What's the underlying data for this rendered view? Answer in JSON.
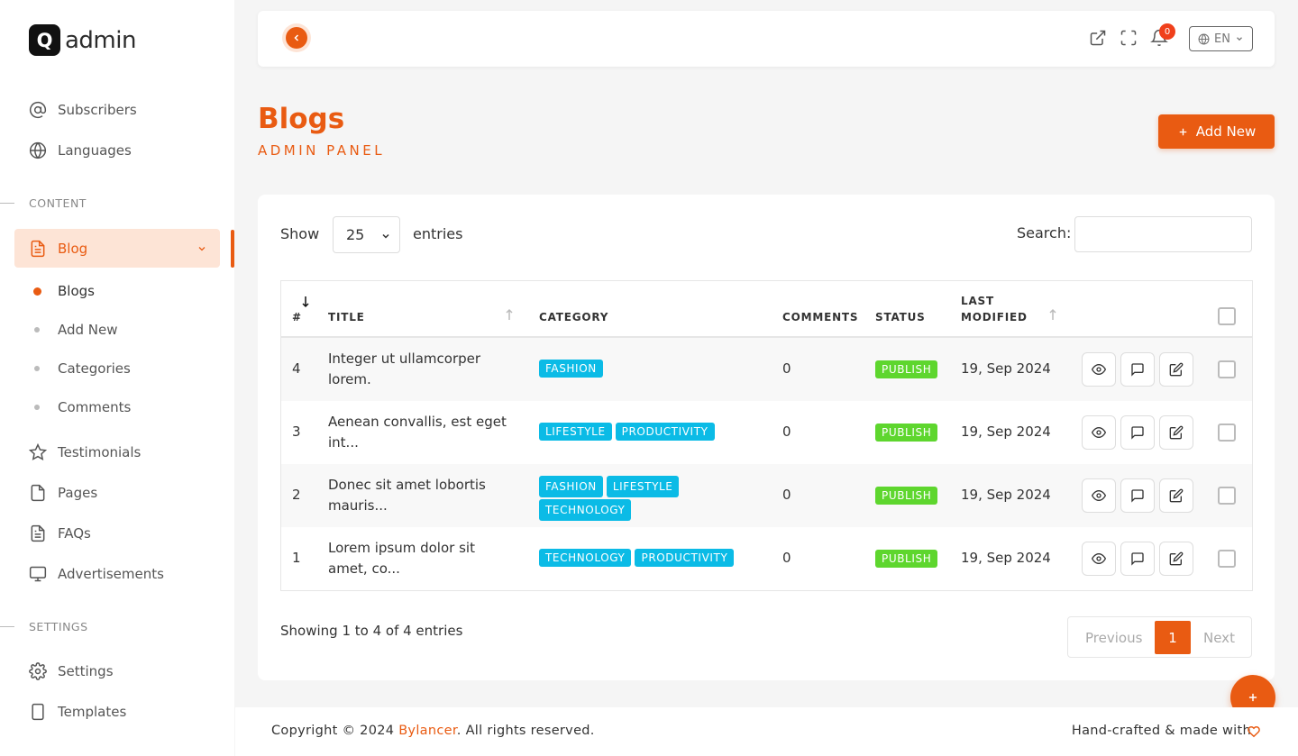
{
  "brand": {
    "logo_letter": "Q",
    "name": "admin"
  },
  "sidebar": {
    "items_top": [
      {
        "label": "Subscribers",
        "icon": "at-icon"
      },
      {
        "label": "Languages",
        "icon": "globe-icon"
      }
    ],
    "content_section": "CONTENT",
    "blog": {
      "label": "Blog",
      "sub_items": [
        "Blogs",
        "Add New",
        "Categories",
        "Comments"
      ]
    },
    "items_content": [
      {
        "label": "Testimonials",
        "icon": "star-icon"
      },
      {
        "label": "Pages",
        "icon": "page-icon"
      },
      {
        "label": "FAQs",
        "icon": "document-icon"
      },
      {
        "label": "Advertisements",
        "icon": "monitor-icon"
      }
    ],
    "settings_section": "SETTINGS",
    "items_settings": [
      {
        "label": "Settings",
        "icon": "gear-icon"
      },
      {
        "label": "Templates",
        "icon": "tablet-icon"
      }
    ]
  },
  "topbar": {
    "notification_count": "0",
    "language": "EN"
  },
  "page": {
    "title": "Blogs",
    "subtitle": "ADMIN PANEL",
    "add_new_label": "Add New"
  },
  "table_controls": {
    "show_label": "Show",
    "page_size": "25",
    "entries_label": "entries",
    "search_label": "Search:",
    "search_value": ""
  },
  "table": {
    "columns": [
      "#",
      "TITLE",
      "CATEGORY",
      "COMMENTS",
      "STATUS",
      "LAST",
      "MODIFIED"
    ],
    "rows": [
      {
        "id": "4",
        "title": "Integer ut ullamcorper lorem.",
        "categories": [
          "FASHION"
        ],
        "comments": "0",
        "status": "PUBLISH",
        "modified": "19, Sep 2024"
      },
      {
        "id": "3",
        "title": "Aenean convallis, est eget int...",
        "categories": [
          "LIFESTYLE",
          "PRODUCTIVITY"
        ],
        "comments": "0",
        "status": "PUBLISH",
        "modified": "19, Sep 2024"
      },
      {
        "id": "2",
        "title": "Donec sit amet lobortis mauris...",
        "categories": [
          "FASHION",
          "LIFESTYLE",
          "TECHNOLOGY"
        ],
        "comments": "0",
        "status": "PUBLISH",
        "modified": "19, Sep 2024"
      },
      {
        "id": "1",
        "title": "Lorem ipsum dolor sit amet, co...",
        "categories": [
          "TECHNOLOGY",
          "PRODUCTIVITY"
        ],
        "comments": "0",
        "status": "PUBLISH",
        "modified": "19, Sep 2024"
      }
    ]
  },
  "pagination": {
    "summary": "Showing 1 to 4 of 4 entries",
    "previous": "Previous",
    "current": "1",
    "next": "Next"
  },
  "footer": {
    "copyright_prefix": "Copyright © 2024 ",
    "brand": "Bylancer",
    "copyright_suffix": ". All rights reserved.",
    "handcrafted": "Hand-crafted & made with"
  },
  "colors": {
    "accent": "#e95b12",
    "tag": "#0bbbe6",
    "status_publish": "#5ed62e"
  }
}
